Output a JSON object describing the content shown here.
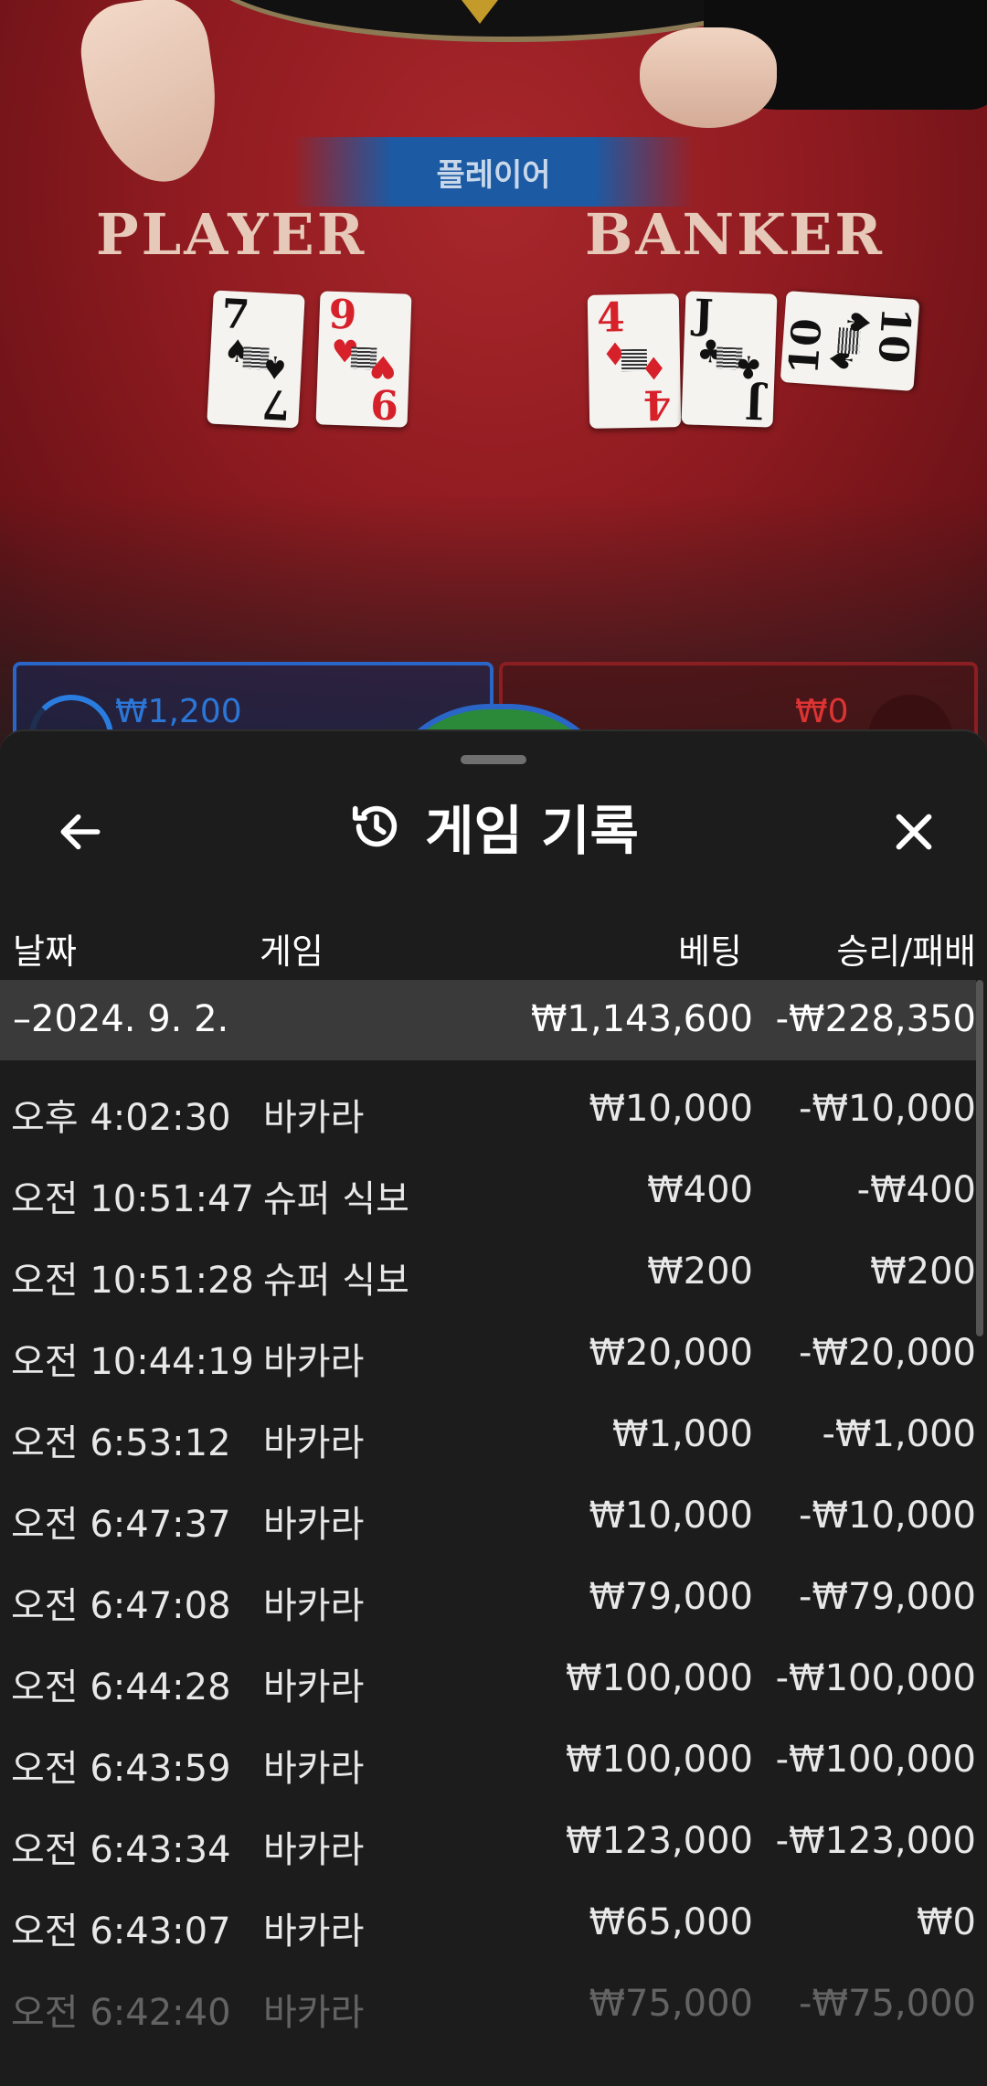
{
  "game": {
    "result_banner": "플레이어",
    "player_label": "PLAYER",
    "banker_label": "BANKER",
    "player_cards": [
      {
        "rank": "7",
        "suit": "♠",
        "color": "black"
      },
      {
        "rank": "9",
        "suit": "♥",
        "color": "red"
      }
    ],
    "banker_cards": [
      {
        "rank": "4",
        "suit": "♦",
        "color": "red"
      },
      {
        "rank": "J",
        "suit": "♣",
        "color": "black"
      },
      {
        "rank": "10",
        "suit": "♠",
        "color": "black"
      }
    ],
    "player_bet": "₩1,200",
    "banker_bet": "₩0"
  },
  "sheet": {
    "title": "게임 기록",
    "back_icon": "arrow-left-icon",
    "history_icon": "history-icon",
    "close_icon": "close-icon",
    "columns": {
      "date": "날짜",
      "game": "게임",
      "bet": "베팅",
      "winloss": "승리/패배"
    },
    "date_group": {
      "date": "–2024. 9. 2.",
      "bet": "₩1,143,600",
      "winloss": "-₩228,350"
    },
    "rows": [
      {
        "time": "오후 4:02:30",
        "game": "바카라",
        "bet": "₩10,000",
        "winloss": "-₩10,000"
      },
      {
        "time": "오전 10:51:47",
        "game": "슈퍼 식보",
        "bet": "₩400",
        "winloss": "-₩400"
      },
      {
        "time": "오전 10:51:28",
        "game": "슈퍼 식보",
        "bet": "₩200",
        "winloss": "₩200"
      },
      {
        "time": "오전 10:44:19",
        "game": "바카라",
        "bet": "₩20,000",
        "winloss": "-₩20,000"
      },
      {
        "time": "오전 6:53:12",
        "game": "바카라",
        "bet": "₩1,000",
        "winloss": "-₩1,000"
      },
      {
        "time": "오전 6:47:37",
        "game": "바카라",
        "bet": "₩10,000",
        "winloss": "-₩10,000"
      },
      {
        "time": "오전 6:47:08",
        "game": "바카라",
        "bet": "₩79,000",
        "winloss": "-₩79,000"
      },
      {
        "time": "오전 6:44:28",
        "game": "바카라",
        "bet": "₩100,000",
        "winloss": "-₩100,000"
      },
      {
        "time": "오전 6:43:59",
        "game": "바카라",
        "bet": "₩100,000",
        "winloss": "-₩100,000"
      },
      {
        "time": "오전 6:43:34",
        "game": "바카라",
        "bet": "₩123,000",
        "winloss": "-₩123,000"
      },
      {
        "time": "오전 6:43:07",
        "game": "바카라",
        "bet": "₩65,000",
        "winloss": "₩0"
      },
      {
        "time": "오전 6:42:40",
        "game": "바카라",
        "bet": "₩75,000",
        "winloss": "-₩75,000"
      }
    ]
  }
}
